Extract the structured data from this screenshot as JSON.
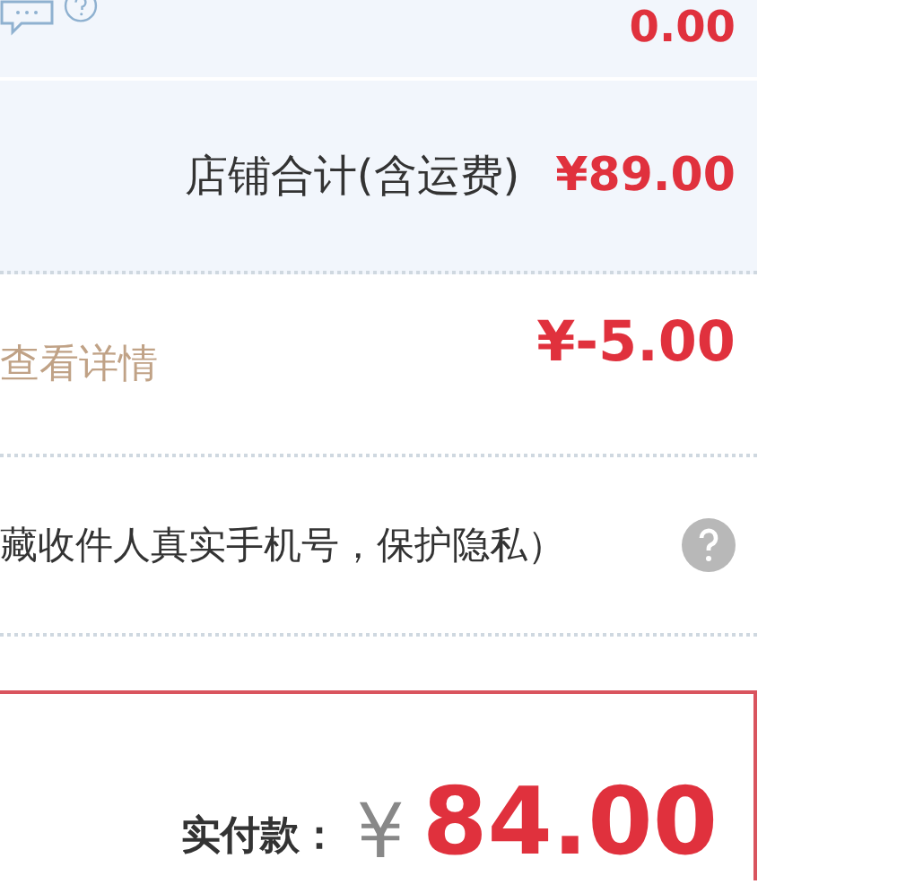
{
  "rows": [
    {
      "kind": "fee",
      "amount": "0.00"
    },
    {
      "kind": "subtotal",
      "label": "店铺合计(含运费)",
      "amount": "¥89.00"
    },
    {
      "kind": "discount",
      "link": "查看详情",
      "amount": "¥-5.00"
    },
    {
      "kind": "privacy",
      "label": "藏收件人真实手机号，保护隐私）"
    }
  ],
  "payment": {
    "label": "实付款：",
    "currency": "¥",
    "amount": "84.00"
  }
}
